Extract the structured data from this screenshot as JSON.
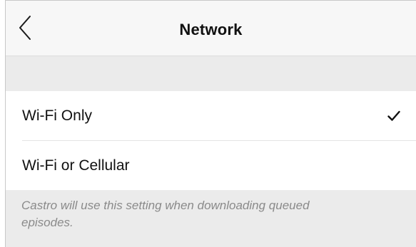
{
  "nav": {
    "title": "Network",
    "back_icon": "chevron-left-icon"
  },
  "options": [
    {
      "label": "Wi-Fi Only",
      "selected": true
    },
    {
      "label": "Wi-Fi or Cellular",
      "selected": false
    }
  ],
  "selected_icon": "checkmark-icon",
  "footer": {
    "note": "Castro will use this setting when downloading queued episodes."
  },
  "colors": {
    "nav_background": "#f7f7f7",
    "group_background": "#ebebeb",
    "row_background": "#ffffff",
    "text": "#111111",
    "footnote_text": "#8a8a8a"
  }
}
